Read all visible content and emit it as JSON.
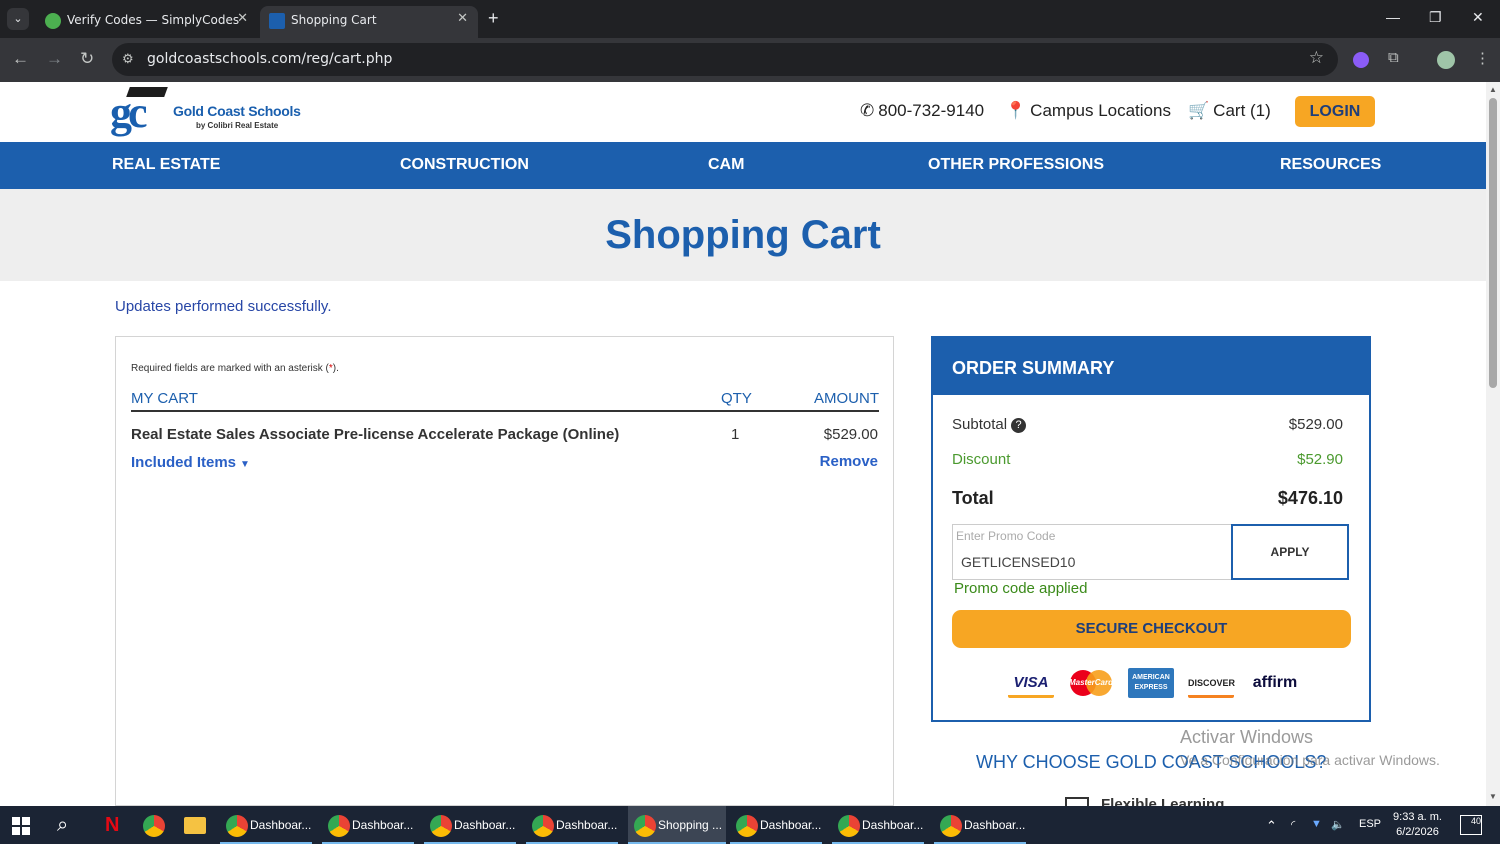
{
  "browser": {
    "tabs": [
      {
        "title": "Verify Codes — SimplyCodes",
        "active": false,
        "favicon_color": "#4caf50"
      },
      {
        "title": "Shopping Cart",
        "active": true,
        "favicon_color": "#1c5fad"
      }
    ],
    "url": "goldcoastschools.com/reg/cart.php"
  },
  "header": {
    "logo_mark": "gc",
    "logo_name": "Gold Coast Schools",
    "logo_sub": "by Colibri Real Estate",
    "phone": "800-732-9140",
    "campus": "Campus Locations",
    "cart": "Cart (1)",
    "login": "LOGIN"
  },
  "nav": [
    "REAL ESTATE",
    "CONSTRUCTION",
    "CAM",
    "OTHER PROFESSIONS",
    "RESOURCES"
  ],
  "hero_title": "Shopping Cart",
  "update_message": "Updates performed successfully.",
  "cart": {
    "required_note": "Required fields are marked with an asterisk (",
    "required_ast": "*",
    "required_end": ").",
    "col_item": "MY CART",
    "col_qty": "QTY",
    "col_amount": "AMOUNT",
    "item_name": "Real Estate Sales Associate Pre-license Accelerate Package (Online)",
    "item_qty": "1",
    "item_amount": "$529.00",
    "included": "Included Items",
    "remove": "Remove"
  },
  "summary": {
    "title": "ORDER SUMMARY",
    "subtotal_label": "Subtotal",
    "subtotal_value": "$529.00",
    "discount_label": "Discount",
    "discount_value": "$52.90",
    "total_label": "Total",
    "total_value": "$476.10",
    "promo_placeholder": "Enter Promo Code",
    "promo_value": "GETLICENSED10",
    "apply": "APPLY",
    "promo_status": "Promo code applied",
    "checkout": "SECURE CHECKOUT",
    "cards": {
      "visa": "VISA",
      "mastercard": "MasterCard",
      "amex": "AMERICAN EXPRESS",
      "discover": "DISCOVER",
      "affirm": "affirm"
    }
  },
  "why_title": "WHY CHOOSE GOLD COAST SCHOOLS?",
  "flex_learning": "Flexible Learning",
  "watermark": {
    "line1": "Activar Windows",
    "line2": "Ve a Configuración para activar Windows."
  },
  "taskbar": {
    "apps": [
      {
        "label": "Dashboar...",
        "badge": "Y"
      },
      {
        "label": "Dashboar...",
        "badge": "A"
      },
      {
        "label": "Dashboar...",
        "badge": ""
      },
      {
        "label": "Dashboar...",
        "badge": "J"
      },
      {
        "label": "Shopping ...",
        "badge": ""
      },
      {
        "label": "Dashboar...",
        "badge": ""
      },
      {
        "label": "Dashboar...",
        "badge": ""
      },
      {
        "label": "Dashboar...",
        "badge": "F"
      }
    ],
    "lang": "ESP",
    "time": "9:33 a. m.",
    "date": "6/2/2026",
    "notifications": "40"
  }
}
